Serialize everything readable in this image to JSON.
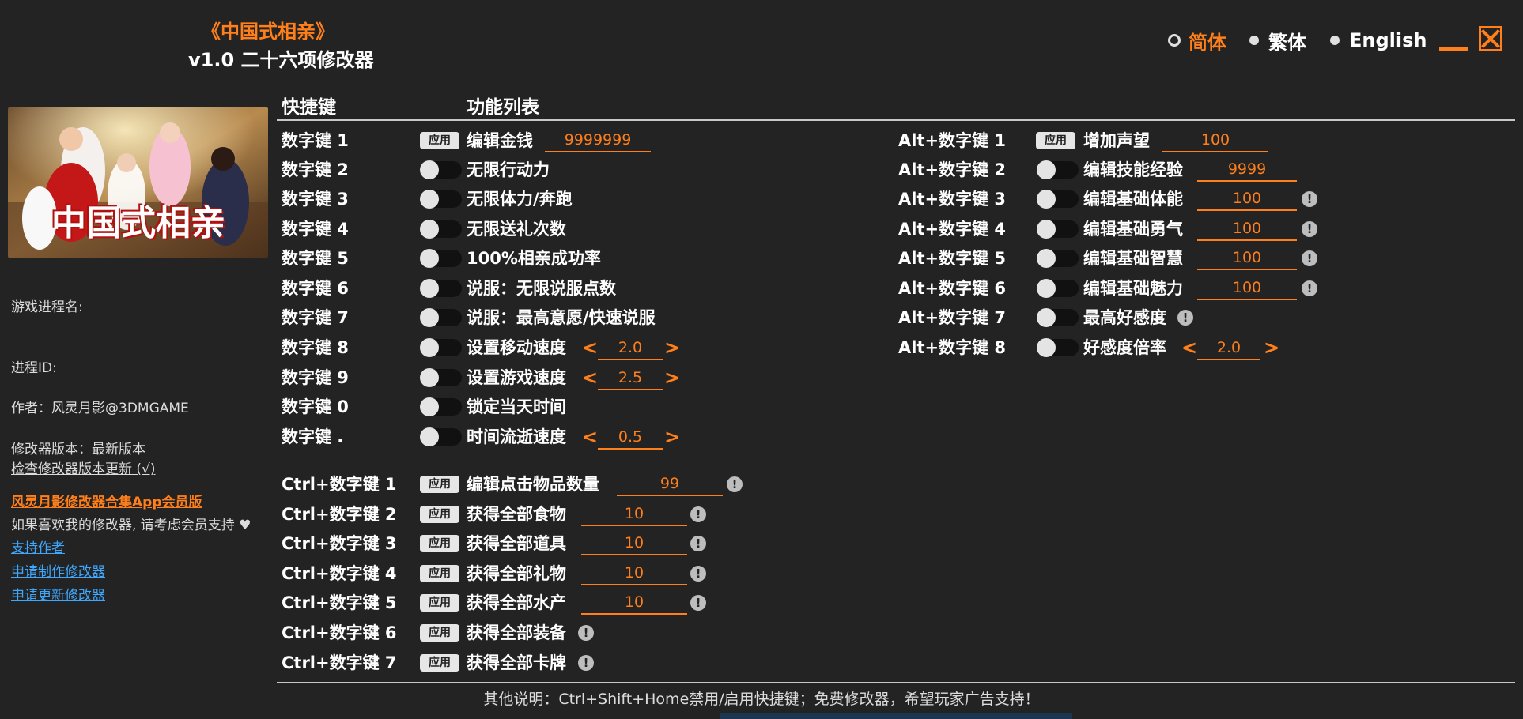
{
  "header": {
    "game_title": "《中国式相亲》",
    "subtitle": "v1.0 二十六项修改器"
  },
  "languages": [
    {
      "label": "简体",
      "selected": true
    },
    {
      "label": "繁体",
      "selected": false
    },
    {
      "label": "English",
      "selected": false
    }
  ],
  "sidebar": {
    "cover_text": "中国式相亲",
    "process_name_label": "游戏进程名:",
    "process_id_label": "进程ID:",
    "author": "作者：风灵月影@3DMGAME",
    "version": "修改器版本：最新版本",
    "check_update": "检查修改器版本更新 (√)",
    "app_link": "风灵月影修改器合集App会员版",
    "support_note": "如果喜欢我的修改器, 请考虑会员支持",
    "support_author": "支持作者",
    "request_make": "申请制作修改器",
    "request_update": "申请更新修改器"
  },
  "columns": {
    "hotkey": "快捷键",
    "features": "功能列表"
  },
  "colors": {
    "accent": "#ff7f1a",
    "background": "#232323",
    "link": "#3ea8ff"
  },
  "numpad_rows": [
    {
      "key": "数字键 1",
      "control": "apply",
      "label": "编辑金钱",
      "value": "9999999"
    },
    {
      "key": "数字键 2",
      "control": "toggle",
      "label": "无限行动力"
    },
    {
      "key": "数字键 3",
      "control": "toggle",
      "label": "无限体力/奔跑"
    },
    {
      "key": "数字键 4",
      "control": "toggle",
      "label": "无限送礼次数"
    },
    {
      "key": "数字键 5",
      "control": "toggle",
      "label": "100%相亲成功率"
    },
    {
      "key": "数字键 6",
      "control": "toggle",
      "label": "说服：无限说服点数"
    },
    {
      "key": "数字键 7",
      "control": "toggle",
      "label": "说服：最高意愿/快速说服"
    },
    {
      "key": "数字键 8",
      "control": "toggle",
      "label": "设置移动速度",
      "value": "2.0"
    },
    {
      "key": "数字键 9",
      "control": "toggle",
      "label": "设置游戏速度",
      "value": "2.5"
    },
    {
      "key": "数字键 0",
      "control": "toggle",
      "label": "锁定当天时间"
    },
    {
      "key": "数字键 .",
      "control": "toggle",
      "label": "时间流逝速度",
      "value": "0.5"
    }
  ],
  "ctrl_rows": [
    {
      "key": "Ctrl+数字键 1",
      "control": "apply",
      "label": "编辑点击物品数量",
      "value": "99"
    },
    {
      "key": "Ctrl+数字键 2",
      "control": "apply",
      "label": "获得全部食物",
      "value": "10"
    },
    {
      "key": "Ctrl+数字键 3",
      "control": "apply",
      "label": "获得全部道具",
      "value": "10"
    },
    {
      "key": "Ctrl+数字键 4",
      "control": "apply",
      "label": "获得全部礼物",
      "value": "10"
    },
    {
      "key": "Ctrl+数字键 5",
      "control": "apply",
      "label": "获得全部水产",
      "value": "10"
    },
    {
      "key": "Ctrl+数字键 6",
      "control": "apply",
      "label": "获得全部装备"
    },
    {
      "key": "Ctrl+数字键 7",
      "control": "apply",
      "label": "获得全部卡牌"
    }
  ],
  "alt_rows": [
    {
      "key": "Alt+数字键 1",
      "control": "apply",
      "label": "增加声望",
      "value": "100"
    },
    {
      "key": "Alt+数字键 2",
      "control": "toggle",
      "label": "编辑技能经验",
      "value": "9999"
    },
    {
      "key": "Alt+数字键 3",
      "control": "toggle",
      "label": "编辑基础体能",
      "value": "100"
    },
    {
      "key": "Alt+数字键 4",
      "control": "toggle",
      "label": "编辑基础勇气",
      "value": "100"
    },
    {
      "key": "Alt+数字键 5",
      "control": "toggle",
      "label": "编辑基础智慧",
      "value": "100"
    },
    {
      "key": "Alt+数字键 6",
      "control": "toggle",
      "label": "编辑基础魅力",
      "value": "100"
    },
    {
      "key": "Alt+数字键 7",
      "control": "toggle",
      "label": "最高好感度"
    },
    {
      "key": "Alt+数字键 8",
      "control": "toggle",
      "label": "好感度倍率",
      "value": "2.0"
    }
  ],
  "apply_label": "应用",
  "info_mark": "!",
  "arrow_left": "<",
  "arrow_right": ">",
  "footer": "其他说明：Ctrl+Shift+Home禁用/启用快捷键；免费修改器，希望玩家广告支持！"
}
